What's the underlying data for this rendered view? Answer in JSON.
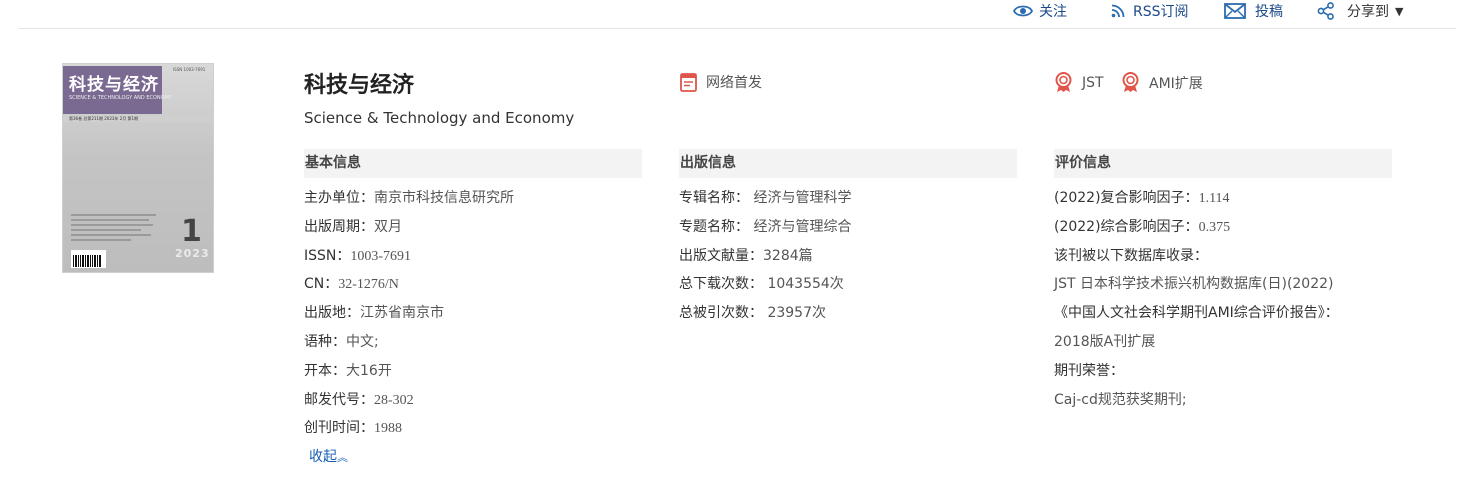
{
  "topbar": {
    "follow": "关注",
    "rss": "RSS订阅",
    "submit": "投稿",
    "share": "分享到"
  },
  "cover": {
    "title": "科技与经济",
    "subtitle": "SCIENCE & TECHNOLOGY AND ECONOMY",
    "issue_line": "第36卷 总第211期 2023年 2月 第1期",
    "issn": "ISSN 1003-7691",
    "issue_number": "1",
    "year": "2023"
  },
  "journal": {
    "title_cn": "科技与经济",
    "title_en": "Science & Technology and Economy"
  },
  "badges": {
    "online_first": "网络首发",
    "jst": "JST",
    "ami": "AMI扩展"
  },
  "basic": {
    "heading": "基本信息",
    "rows": [
      {
        "label": "主办单位：",
        "value": "南京市科技信息研究所"
      },
      {
        "label": "出版周期：",
        "value": "双月"
      },
      {
        "label": "ISSN：",
        "value": "1003-7691"
      },
      {
        "label": "CN：",
        "value": "32-1276/N"
      },
      {
        "label": "出版地：",
        "value": "江苏省南京市"
      },
      {
        "label": "语种：",
        "value": "中文;"
      },
      {
        "label": "开本：",
        "value": "大16开"
      },
      {
        "label": "邮发代号：",
        "value": "28-302"
      },
      {
        "label": "创刊时间：",
        "value": "1988"
      }
    ],
    "collapse": "收起"
  },
  "publish": {
    "heading": "出版信息",
    "rows": [
      {
        "label": "专辑名称：",
        "value": "经济与管理科学"
      },
      {
        "label": "专题名称：",
        "value": "经济与管理综合"
      },
      {
        "label": "出版文献量：",
        "value": "3284篇"
      },
      {
        "label": "总下载次数：",
        "value": "1043554次"
      },
      {
        "label": "总被引次数：",
        "value": "23957次"
      }
    ]
  },
  "evaluation": {
    "heading": "评价信息",
    "if_composite_label": "(2022)复合影响因子：",
    "if_composite_value": "1.114",
    "if_comprehensive_label": "(2022)综合影响因子：",
    "if_comprehensive_value": "0.375",
    "db_label": "该刊被以下数据库收录：",
    "db_value": "JST 日本科学技术振兴机构数据库(日)(2022)",
    "ami_label": "《中国人文社会科学期刊AMI综合评价报告》：",
    "ami_value": "2018版A刊扩展",
    "honor_label": "期刊荣誉：",
    "honor_value": "Caj-cd规范获奖期刊;"
  },
  "colors": {
    "link": "#1a5fb4",
    "icon_blue": "#2b6cb0",
    "badge_red": "#e0564a",
    "header_bg": "#f3f3f3"
  }
}
